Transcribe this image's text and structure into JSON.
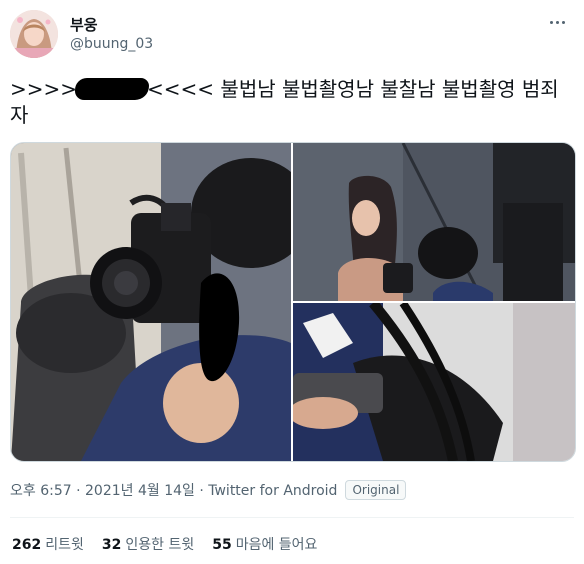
{
  "author": {
    "display_name": "부웅",
    "handle": "@buung_03"
  },
  "tweet": {
    "text_prefix": ">>>>",
    "text_suffix": "<<<< 불법남 불법촬영남 불찰남 불법촬영 범죄자"
  },
  "meta": {
    "time": "오후 6:57 · 2021년 4월 14일 · Twitter for Android",
    "source_badge": "Original"
  },
  "stats": [
    {
      "count": "262",
      "label": "리트윗"
    },
    {
      "count": "32",
      "label": "인용한 트윗"
    },
    {
      "count": "55",
      "label": "마음에 들어요"
    }
  ],
  "colors": {
    "text_primary": "#0f1419",
    "text_secondary": "#536471",
    "border": "#cfd9de"
  }
}
